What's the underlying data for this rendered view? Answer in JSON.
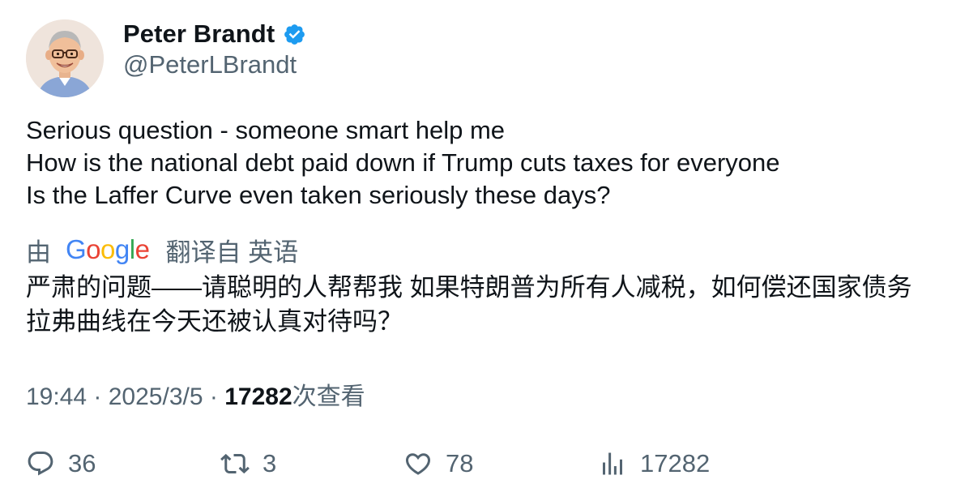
{
  "author": {
    "display_name": "Peter Brandt",
    "handle": "@PeterLBrandt",
    "verified_icon": "verified-badge-icon",
    "avatar_icon": "cartoon-man-avatar"
  },
  "tweet": {
    "lines": [
      "Serious question - someone smart help me",
      "How is the national debt paid down if Trump cuts taxes for everyone",
      "Is the Laffer Curve even taken seriously these days?"
    ]
  },
  "translation": {
    "prefix": "由",
    "provider_letters": [
      "G",
      "o",
      "o",
      "g",
      "l",
      "e"
    ],
    "suffix": "翻译自 英语",
    "lines": [
      "严肃的问题——请聪明的人帮帮我 如果特朗普为所有人减税，如何偿还国家债务",
      "拉弗曲线在今天还被认真对待吗？"
    ]
  },
  "meta": {
    "time": "19:44",
    "separator": " · ",
    "date": "2025/3/5",
    "views_count": "17282",
    "views_label": "次查看"
  },
  "actions": {
    "replies": "36",
    "reposts": "3",
    "likes": "78",
    "views": "17282"
  },
  "colors": {
    "text_primary": "#0f1419",
    "text_secondary": "#536471",
    "verified_blue": "#1d9bf0"
  }
}
